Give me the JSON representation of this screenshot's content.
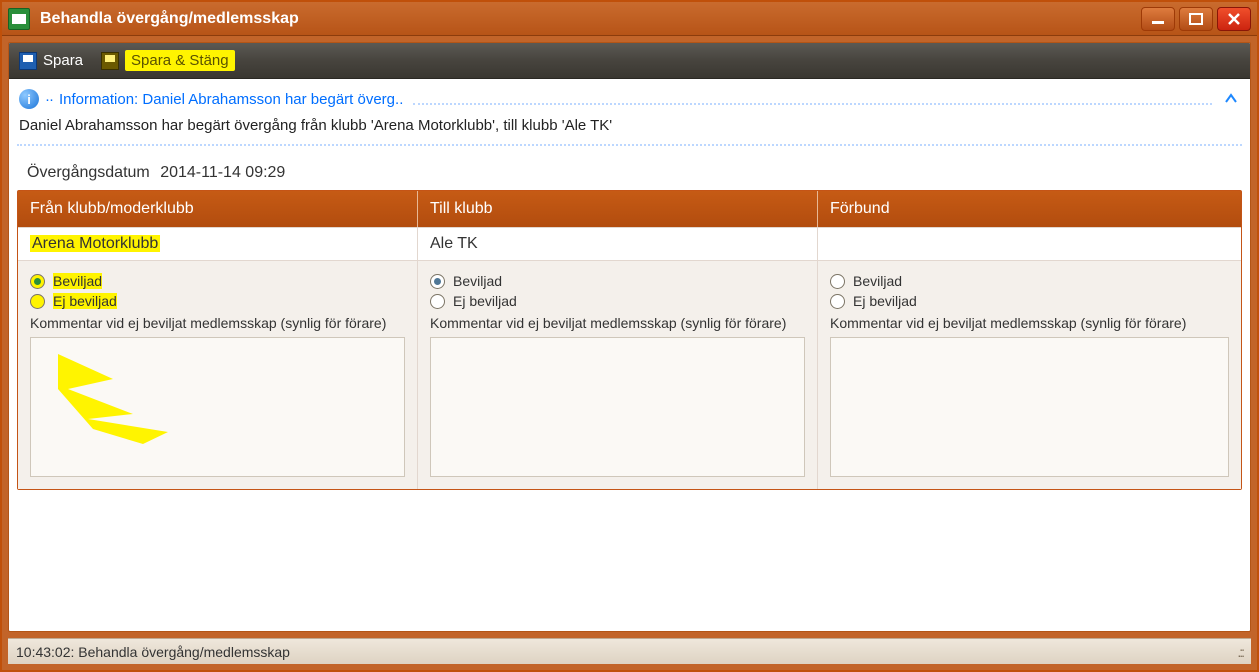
{
  "window": {
    "title": "Behandla övergång/medlemsskap"
  },
  "toolbar": {
    "save": "Spara",
    "save_close": "Spara & Stäng"
  },
  "info": {
    "header": "Information: Daniel Abrahamsson har begärt överg..",
    "detail": "Daniel Abrahamsson har begärt övergång från klubb 'Arena Motorklubb', till klubb 'Ale TK'"
  },
  "date": {
    "label": "Övergångsdatum",
    "value": "2014-11-14 09:29"
  },
  "columns": {
    "from": {
      "header": "Från klubb/moderklubb",
      "club": "Arena Motorklubb",
      "opt_approved": "Beviljad",
      "opt_rejected": "Ej beviljad",
      "selected": "approved",
      "comment_label": "Kommentar vid ej beviljat medlemsskap (synlig för förare)",
      "comment_value": ""
    },
    "to": {
      "header": "Till klubb",
      "club": "Ale TK",
      "opt_approved": "Beviljad",
      "opt_rejected": "Ej beviljad",
      "selected": "approved",
      "comment_label": "Kommentar vid ej beviljat medlemsskap (synlig för förare)",
      "comment_value": ""
    },
    "fed": {
      "header": "Förbund",
      "club": "",
      "opt_approved": "Beviljad",
      "opt_rejected": "Ej beviljad",
      "selected": "",
      "comment_label": "Kommentar vid ej beviljat medlemsskap (synlig för förare)",
      "comment_value": ""
    }
  },
  "status": {
    "text": "10:43:02: Behandla övergång/medlemsskap"
  }
}
